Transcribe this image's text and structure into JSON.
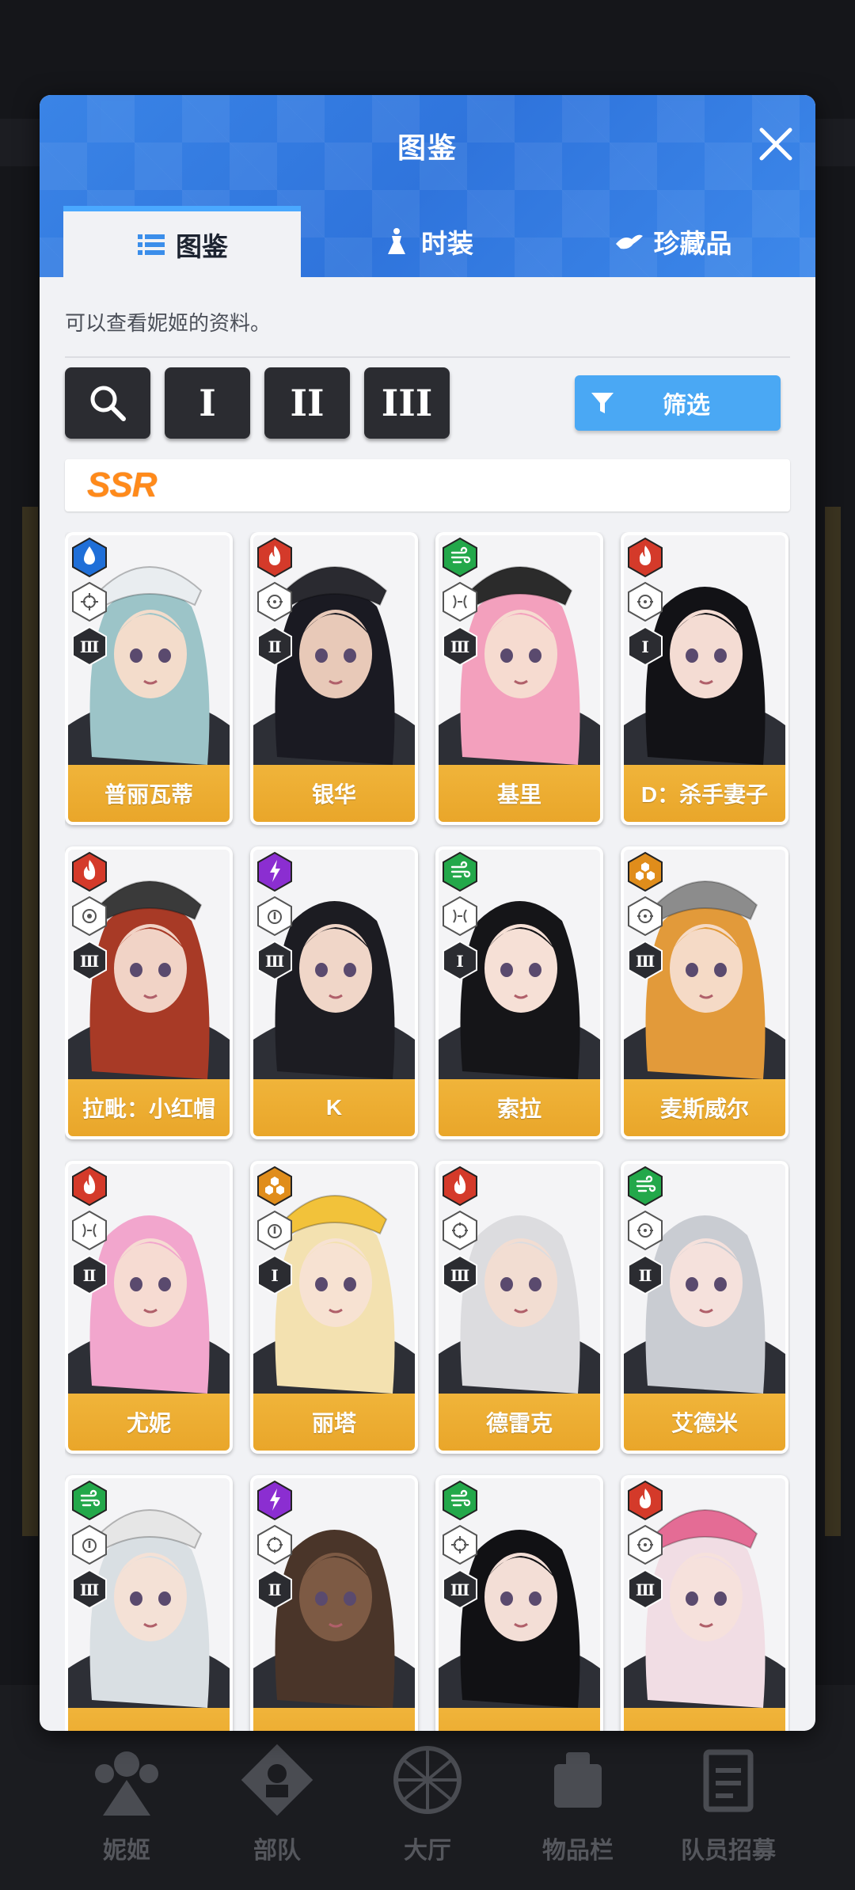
{
  "dialog": {
    "title": "图鉴",
    "tabs": [
      {
        "label": "图鉴",
        "icon": "list-icon",
        "active": true
      },
      {
        "label": "时装",
        "icon": "dress-icon",
        "active": false
      },
      {
        "label": "珍藏品",
        "icon": "treasure-icon",
        "active": false
      }
    ],
    "info": "可以查看妮姬的资料。",
    "tool_buttons": [
      "I",
      "II",
      "III"
    ],
    "filter_label": "筛选",
    "rarity": "SSR"
  },
  "cards": [
    {
      "name": "普丽瓦蒂",
      "element": "water",
      "element_color": "#1f6fd8",
      "burst": "Ⅲ",
      "weapon": "crosshair-icon",
      "hair": "#9cc4c8",
      "skin": "#f3dccb",
      "hat": "#e9edf0"
    },
    {
      "name": "银华",
      "element": "fire",
      "element_color": "#d43a2a",
      "burst": "Ⅱ",
      "weapon": "scope-icon",
      "hair": "#1a1a22",
      "skin": "#e8c9b8",
      "hat": "#2a2a30"
    },
    {
      "name": "基里",
      "element": "wind",
      "element_color": "#23a84a",
      "burst": "Ⅲ",
      "weapon": "spread-icon",
      "hair": "#f3a0bd",
      "skin": "#f6dbd0",
      "hat": "#2b2b2b"
    },
    {
      "name": "D：杀手妻子",
      "element": "fire",
      "element_color": "#d43a2a",
      "burst": "Ⅰ",
      "weapon": "scope-icon",
      "hair": "#121216",
      "skin": "#f4dcd3",
      "hat": ""
    },
    {
      "name": "拉毗：小红帽",
      "element": "fire",
      "element_color": "#d43a2a",
      "burst": "Ⅲ",
      "weapon": "target-icon",
      "hair": "#a83a26",
      "skin": "#f1d3c6",
      "hat": "#3a3a3a"
    },
    {
      "name": "K",
      "element": "electric",
      "element_color": "#8b2ed1",
      "burst": "Ⅲ",
      "weapon": "rocket-icon",
      "hair": "#1c1c22",
      "skin": "#f0d6c8",
      "hat": ""
    },
    {
      "name": "索拉",
      "element": "wind",
      "element_color": "#23a84a",
      "burst": "Ⅰ",
      "weapon": "spread-icon",
      "hair": "#151518",
      "skin": "#f6e0d6",
      "hat": ""
    },
    {
      "name": "麦斯威尔",
      "element": "iron",
      "element_color": "#e08d1b",
      "burst": "Ⅲ",
      "weapon": "scope-icon",
      "hair": "#e29a3a",
      "skin": "#f5dac6",
      "hat": "#8c8c8c"
    },
    {
      "name": "尤妮",
      "element": "fire",
      "element_color": "#d43a2a",
      "burst": "Ⅱ",
      "weapon": "spread-icon",
      "hair": "#f2a6cd",
      "skin": "#f6dbd2",
      "hat": ""
    },
    {
      "name": "丽塔",
      "element": "iron",
      "element_color": "#e08d1b",
      "burst": "Ⅰ",
      "weapon": "rocket-icon",
      "hair": "#f3e1b0",
      "skin": "#f7e2d2",
      "hat": "#f2c23a"
    },
    {
      "name": "德雷克",
      "element": "fire",
      "element_color": "#d43a2a",
      "burst": "Ⅲ",
      "weapon": "mg-icon",
      "hair": "#dcdcdf",
      "skin": "#f2ddd2",
      "hat": ""
    },
    {
      "name": "艾德米",
      "element": "wind",
      "element_color": "#23a84a",
      "burst": "Ⅱ",
      "weapon": "scope-icon",
      "hair": "#c9ccd2",
      "skin": "#f5e1dc",
      "hat": ""
    },
    {
      "name": "",
      "element": "wind",
      "element_color": "#23a84a",
      "burst": "Ⅲ",
      "weapon": "rocket-icon",
      "hair": "#d9dfe3",
      "skin": "#f4e1d6",
      "hat": "#e6e6e6"
    },
    {
      "name": "",
      "element": "electric",
      "element_color": "#8b2ed1",
      "burst": "Ⅱ",
      "weapon": "mg-icon",
      "hair": "#4a3529",
      "skin": "#7d5a44",
      "hat": ""
    },
    {
      "name": "",
      "element": "wind",
      "element_color": "#23a84a",
      "burst": "Ⅲ",
      "weapon": "crosshair-icon",
      "hair": "#111114",
      "skin": "#f3ded6",
      "hat": ""
    },
    {
      "name": "",
      "element": "fire",
      "element_color": "#d43a2a",
      "burst": "Ⅲ",
      "weapon": "scope-icon",
      "hair": "#f1dde4",
      "skin": "#f6e1dc",
      "hat": "#e46c95"
    }
  ],
  "bottom_nav": [
    {
      "label": "妮姬",
      "icon": "nikke-icon"
    },
    {
      "label": "部队",
      "icon": "squad-icon"
    },
    {
      "label": "大厅",
      "icon": "lobby-icon"
    },
    {
      "label": "物品栏",
      "icon": "inventory-icon"
    },
    {
      "label": "队员招募",
      "icon": "recruit-icon"
    }
  ]
}
